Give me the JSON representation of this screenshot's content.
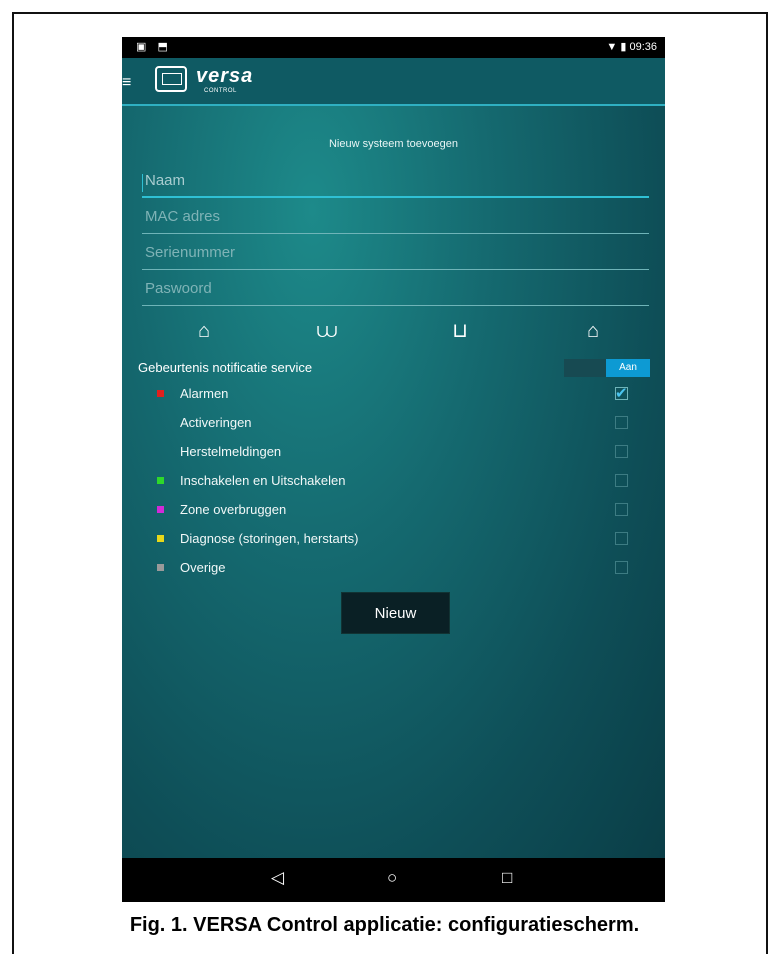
{
  "status_bar": {
    "left_icons": "▣ ⬒",
    "time": "09:36",
    "right_icons": "▼ ▮"
  },
  "app_bar": {
    "menu_icon": "≡",
    "logo_text": "versa",
    "logo_sub": "CONTROL"
  },
  "form": {
    "title": "Nieuw systeem toevoegen",
    "fields": [
      {
        "placeholder": "Naam"
      },
      {
        "placeholder": "MAC adres"
      },
      {
        "placeholder": "Serienummer"
      },
      {
        "placeholder": "Paswoord"
      }
    ]
  },
  "system_icons": [
    "home-icon",
    "boat-house-icon",
    "factory-icon",
    "garage-icon"
  ],
  "notification": {
    "label": "Gebeurtenis notificatie service",
    "toggle_on_label": "Aan",
    "items": [
      {
        "label": "Alarmen",
        "color": "#e0201e",
        "checked": true
      },
      {
        "label": "Activeringen",
        "color": "",
        "checked": false
      },
      {
        "label": "Herstelmeldingen",
        "color": "",
        "checked": false
      },
      {
        "label": "Inschakelen en Uitschakelen",
        "color": "#2ed82a",
        "checked": false
      },
      {
        "label": "Zone overbruggen",
        "color": "#d22ad8",
        "checked": false
      },
      {
        "label": "Diagnose (storingen, herstarts)",
        "color": "#e8d81a",
        "checked": false
      },
      {
        "label": "Overige",
        "color": "#9a9a9a",
        "checked": false
      }
    ]
  },
  "new_button": "Nieuw",
  "nav_bar": {
    "back": "◁",
    "home": "○",
    "recents": "□"
  },
  "caption": "Fig. 1. VERSA Control applicatie: configuratiescherm."
}
